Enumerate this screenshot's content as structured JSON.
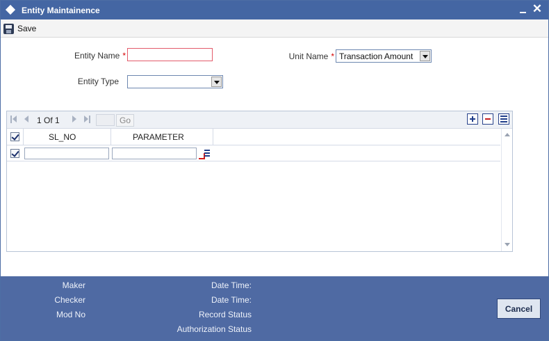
{
  "window": {
    "title": "Entity Maintainence",
    "minimize_icon": "minimize-icon",
    "close_icon": "close-icon",
    "close_glyph": "✕"
  },
  "toolbar": {
    "save_label": "Save",
    "save_icon": "save-icon"
  },
  "form": {
    "entity_name_label": "Entity Name",
    "entity_name_value": "",
    "entity_type_label": "Entity Type",
    "entity_type_value": "",
    "unit_name_label": "Unit Name",
    "unit_name_value": "Transaction Amount",
    "required_mark": "*"
  },
  "grid": {
    "pager_text": "1 Of 1",
    "go_label": "Go",
    "columns": [
      "SL_NO",
      "PARAMETER"
    ],
    "rows": [
      {
        "sl_no": "",
        "parameter": "",
        "checked": true
      }
    ],
    "add_icon": "plus-icon",
    "delete_icon": "minus-icon",
    "view_icon": "list-icon"
  },
  "footer": {
    "maker_label": "Maker",
    "checker_label": "Checker",
    "mod_no_label": "Mod No",
    "date_time_label_1": "Date Time:",
    "date_time_label_2": "Date Time:",
    "record_status_label": "Record Status",
    "authorization_status_label": "Authorization Status",
    "cancel_label": "Cancel"
  },
  "colors": {
    "titlebar": "#4466a3",
    "footer": "#4f6aa3",
    "required": "#d40000"
  }
}
